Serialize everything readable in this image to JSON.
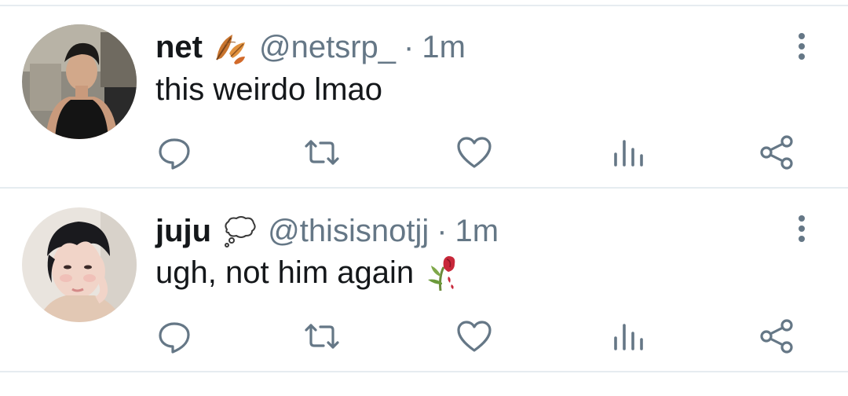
{
  "tweets": [
    {
      "name": "net",
      "name_emoji": "fallen-leaves-emoji",
      "handle": "@netsrp_",
      "separator": "·",
      "time": "1m",
      "text": "this weirdo lmao",
      "text_emoji": ""
    },
    {
      "name": "juju",
      "name_emoji": "thought-balloon-emoji",
      "handle": "@thisisnotjj",
      "separator": "·",
      "time": "1m",
      "text": "ugh, not him again",
      "text_emoji": "wilted-flower-emoji"
    }
  ],
  "actions": [
    "reply-icon",
    "retweet-icon",
    "like-icon",
    "analytics-icon",
    "share-icon"
  ],
  "colors": {
    "icon": "#657786",
    "divider": "#e6ecf0",
    "text": "#14171a",
    "secondary": "#657786"
  }
}
